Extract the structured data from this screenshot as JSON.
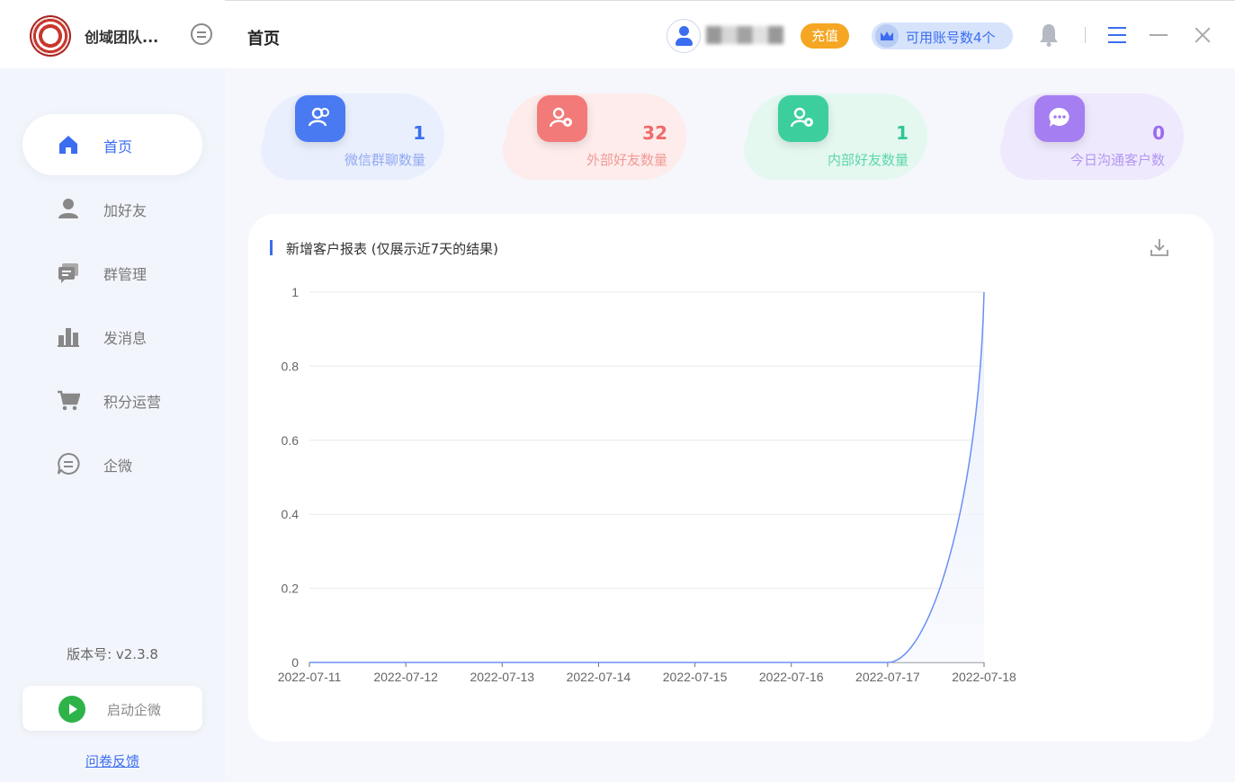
{
  "app": {
    "brand_name": "创域团队...",
    "version_label": "版本号: v2.3.8",
    "launch_label": "启动企微",
    "feedback_label": "问卷反馈"
  },
  "sidebar": {
    "items": [
      {
        "label": "首页",
        "icon": "home-icon"
      },
      {
        "label": "加好友",
        "icon": "user-icon"
      },
      {
        "label": "群管理",
        "icon": "group-chat-icon"
      },
      {
        "label": "发消息",
        "icon": "bar-chart-icon"
      },
      {
        "label": "积分运营",
        "icon": "cart-icon"
      },
      {
        "label": "企微",
        "icon": "chat-bubble-icon"
      }
    ]
  },
  "header": {
    "title": "首页",
    "recharge_label": "充值",
    "accounts_label": "可用账号数4个"
  },
  "stats": [
    {
      "value": "1",
      "label": "微信群聊数量",
      "color": "#3b6df0",
      "bg": "#e9effd",
      "icon_bg": "#4a7af2"
    },
    {
      "value": "32",
      "label": "外部好友数量",
      "color": "#ef6a6a",
      "bg": "#fdeceb",
      "icon_bg": "#f27a78"
    },
    {
      "value": "1",
      "label": "内部好友数量",
      "color": "#2cc695",
      "bg": "#e4f8f0",
      "icon_bg": "#3ccf9d"
    },
    {
      "value": "0",
      "label": "今日沟通客户数",
      "color": "#9b6cf0",
      "bg": "#efe9fd",
      "icon_bg": "#a57ef2"
    }
  ],
  "report": {
    "title": "新增客户报表 (仅展示近7天的结果)"
  },
  "chart_data": {
    "type": "area",
    "title": "新增客户报表 (仅展示近7天的结果)",
    "x": [
      "2022-07-11",
      "2022-07-12",
      "2022-07-13",
      "2022-07-14",
      "2022-07-15",
      "2022-07-16",
      "2022-07-17",
      "2022-07-18"
    ],
    "series": [
      {
        "values": [
          0,
          0,
          0,
          0,
          0,
          0,
          0,
          1
        ]
      }
    ],
    "yticks": [
      "0",
      "0.2",
      "0.4",
      "0.6",
      "0.8",
      "1"
    ],
    "ylim": [
      0,
      1
    ],
    "grid": true,
    "line_color": "#6b8ff5"
  }
}
